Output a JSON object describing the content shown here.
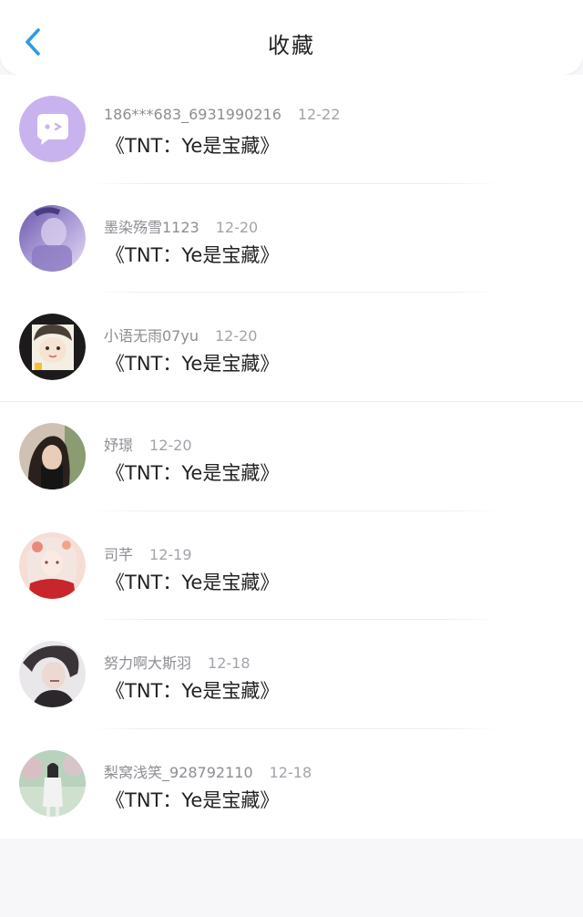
{
  "header": {
    "title": "收藏",
    "back_icon": "chevron-left-icon",
    "accent_color": "#2f9be6"
  },
  "items": [
    {
      "username": "186***683_6931990216",
      "date": "12-22",
      "text": "《TNT：Ye是宝藏》",
      "avatar": "chat-bubble-logo"
    },
    {
      "username": "墨染殇雪1123",
      "date": "12-20",
      "text": "《TNT：Ye是宝藏》",
      "avatar": "photo-purple"
    },
    {
      "username": "小语无雨07yu",
      "date": "12-20",
      "text": "《TNT：Ye是宝藏》",
      "avatar": "photo-cartoon-face"
    },
    {
      "username": "妤璟",
      "date": "12-20",
      "text": "《TNT：Ye是宝藏》",
      "avatar": "photo-portrait"
    },
    {
      "username": "司芊",
      "date": "12-19",
      "text": "《TNT：Ye是宝藏》",
      "avatar": "photo-anime-red"
    },
    {
      "username": "努力啊大斯羽",
      "date": "12-18",
      "text": "《TNT：Ye是宝藏》",
      "avatar": "photo-anime-dark"
    },
    {
      "username": "梨窝浅笑_928792110",
      "date": "12-18",
      "text": "《TNT：Ye是宝藏》",
      "avatar": "photo-girl-park"
    }
  ]
}
